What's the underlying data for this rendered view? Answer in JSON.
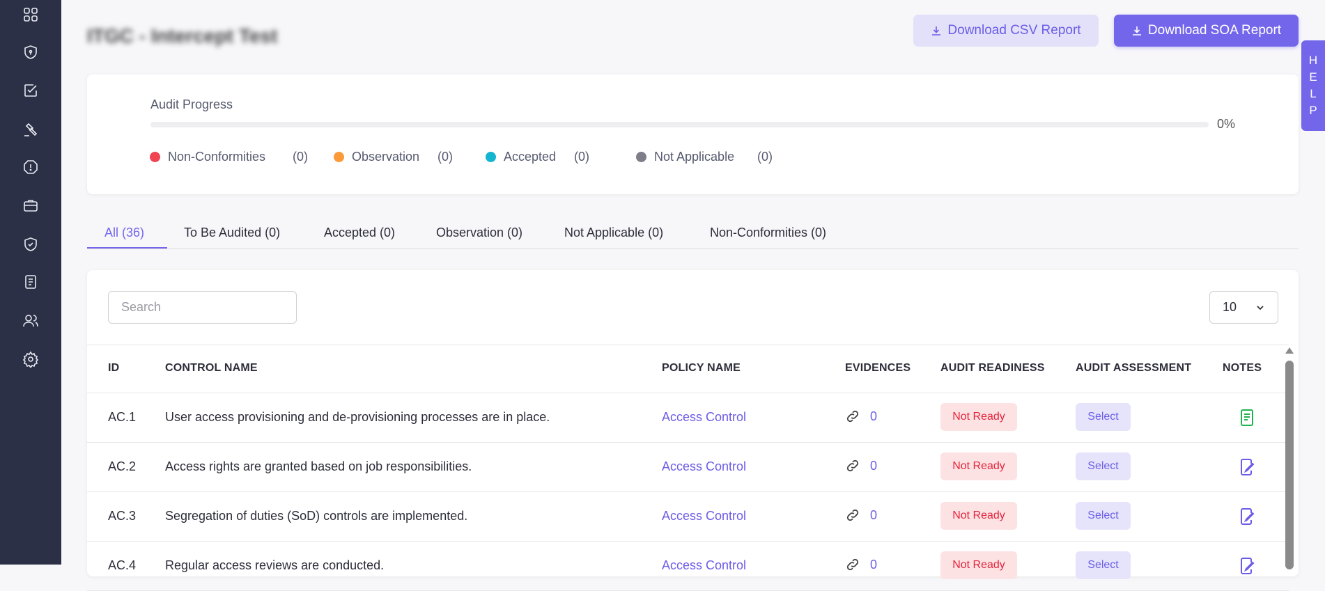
{
  "page_title": "ITGC - Intercept Test",
  "header": {
    "csv_button": "Download CSV Report",
    "soa_button": "Download SOA Report"
  },
  "help_tab": [
    "H",
    "E",
    "L",
    "P"
  ],
  "sidebar": {
    "icons": [
      "dashboard-icon",
      "shield-lock-icon",
      "checkbox-icon",
      "gavel-icon",
      "alert-octagon-icon",
      "briefcase-icon",
      "shield-check-icon",
      "document-icon",
      "users-icon",
      "settings-icon"
    ]
  },
  "progress": {
    "label": "Audit Progress",
    "percent_value": 0,
    "percent_text": "0%",
    "legend": [
      {
        "label": "Non-Conformities",
        "count": "(0)",
        "color": "#f04452"
      },
      {
        "label": "Observation",
        "count": "(0)",
        "color": "#fb9a38"
      },
      {
        "label": "Accepted",
        "count": "(0)",
        "color": "#13b5cf"
      },
      {
        "label": "Not Applicable",
        "count": "(0)",
        "color": "#7d7e88"
      }
    ]
  },
  "tabs": [
    "All (36)",
    "To Be Audited (0)",
    "Accepted (0)",
    "Observation (0)",
    "Not Applicable (0)",
    "Non-Conformities (0)"
  ],
  "table": {
    "search_placeholder": "Search",
    "page_size": "10",
    "columns": [
      "ID",
      "CONTROL NAME",
      "POLICY NAME",
      "EVIDENCES",
      "AUDIT READINESS",
      "AUDIT ASSESSMENT",
      "NOTES"
    ],
    "rows": [
      {
        "id": "AC.1",
        "control": "User access provisioning and de-provisioning processes are in place.",
        "policy": "Access Control",
        "evidences": "0",
        "readiness": "Not Ready",
        "assessment": "Select",
        "note_icon": "note-filled-icon"
      },
      {
        "id": "AC.2",
        "control": "Access rights are granted based on job responsibilities.",
        "policy": "Access Control",
        "evidences": "0",
        "readiness": "Not Ready",
        "assessment": "Select",
        "note_icon": "note-edit-icon"
      },
      {
        "id": "AC.3",
        "control": "Segregation of duties (SoD) controls are implemented.",
        "policy": "Access Control",
        "evidences": "0",
        "readiness": "Not Ready",
        "assessment": "Select",
        "note_icon": "note-edit-icon"
      },
      {
        "id": "AC.4",
        "control": "Regular access reviews are conducted.",
        "policy": "Access Control",
        "evidences": "0",
        "readiness": "Not Ready",
        "assessment": "Select",
        "note_icon": "note-edit-icon"
      }
    ]
  }
}
